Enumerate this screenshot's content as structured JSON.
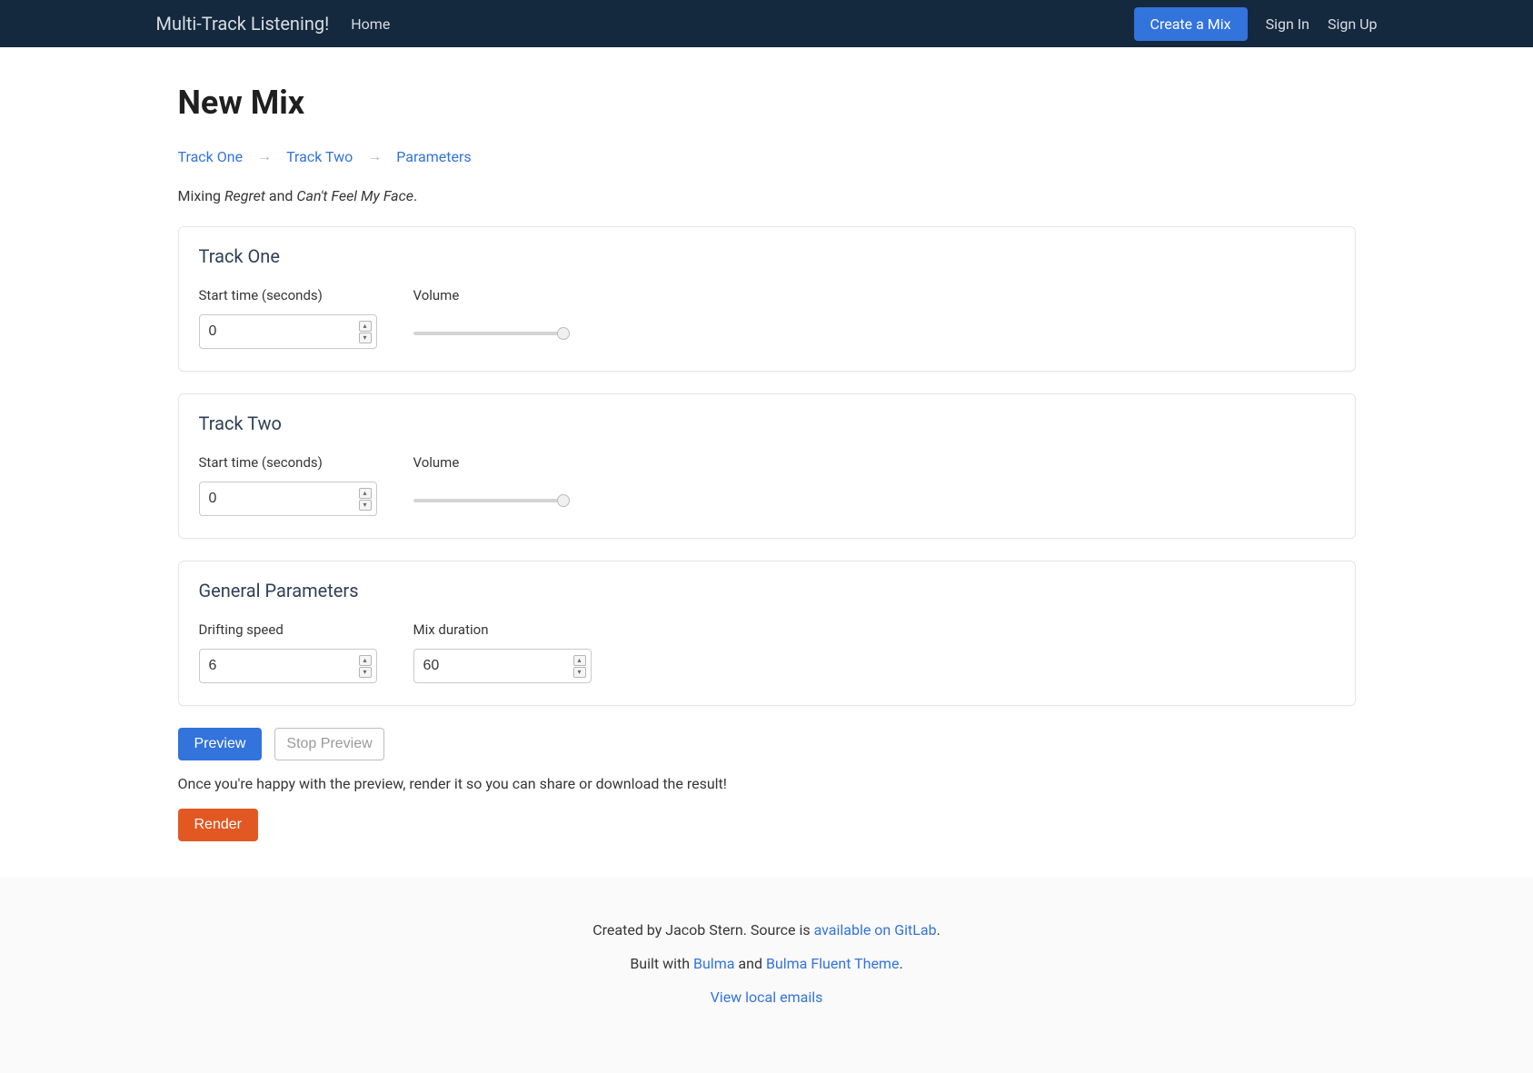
{
  "nav": {
    "brand": "Multi-Track Listening!",
    "home": "Home",
    "create": "Create a Mix",
    "signin": "Sign In",
    "signup": "Sign Up"
  },
  "page": {
    "title": "New Mix"
  },
  "breadcrumb": {
    "step1": "Track One",
    "step2": "Track Two",
    "step3": "Parameters",
    "sep": "→"
  },
  "mixing": {
    "prefix": "Mixing ",
    "track1": "Regret",
    "and": " and ",
    "track2": "Can't Feel My Face",
    "suffix": "."
  },
  "track_one": {
    "heading": "Track One",
    "start_label": "Start time (seconds)",
    "start_value": "0",
    "volume_label": "Volume",
    "volume_value": "100"
  },
  "track_two": {
    "heading": "Track Two",
    "start_label": "Start time (seconds)",
    "start_value": "0",
    "volume_label": "Volume",
    "volume_value": "100"
  },
  "general": {
    "heading": "General Parameters",
    "drift_label": "Drifting speed",
    "drift_value": "6",
    "duration_label": "Mix duration",
    "duration_value": "60"
  },
  "actions": {
    "preview": "Preview",
    "stop_preview": "Stop Preview",
    "help": "Once you're happy with the preview, render it so you can share or download the result!",
    "render": "Render"
  },
  "footer": {
    "line1a": "Created by Jacob Stern. Source is ",
    "line1_link": "available on GitLab",
    "line1b": ".",
    "line2a": "Built with ",
    "line2_link1": "Bulma",
    "line2b": " and ",
    "line2_link2": "Bulma Fluent Theme",
    "line2c": ".",
    "line3_link": "View local emails"
  }
}
